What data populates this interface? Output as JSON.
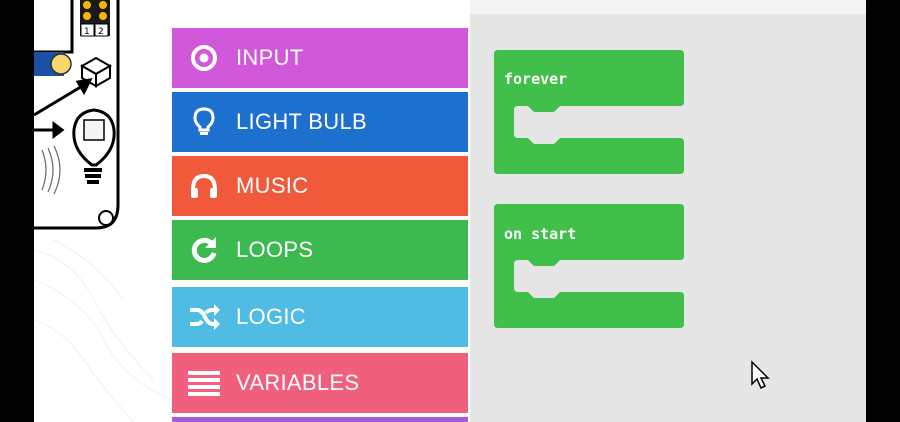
{
  "toolbox": {
    "categories": [
      {
        "label": "INPUT",
        "color": "#d159d9",
        "icon": "target-icon"
      },
      {
        "label": "LIGHT BULB",
        "color": "#1e70cf",
        "icon": "light-bulb-icon"
      },
      {
        "label": "MUSIC",
        "color": "#f05a3b",
        "icon": "headphones-icon"
      },
      {
        "label": "LOOPS",
        "color": "#3cba4f",
        "icon": "refresh-icon"
      },
      {
        "label": "LOGIC",
        "color": "#50bce3",
        "icon": "shuffle-icon"
      },
      {
        "label": "VARIABLES",
        "color": "#f0607d",
        "icon": "list-icon"
      }
    ]
  },
  "workspace": {
    "blocks": [
      {
        "label": "forever",
        "color": "#40bf4a"
      },
      {
        "label": "on start",
        "color": "#40bf4a"
      }
    ]
  },
  "simulator": {
    "pin_labels": [
      "1",
      "2"
    ]
  }
}
